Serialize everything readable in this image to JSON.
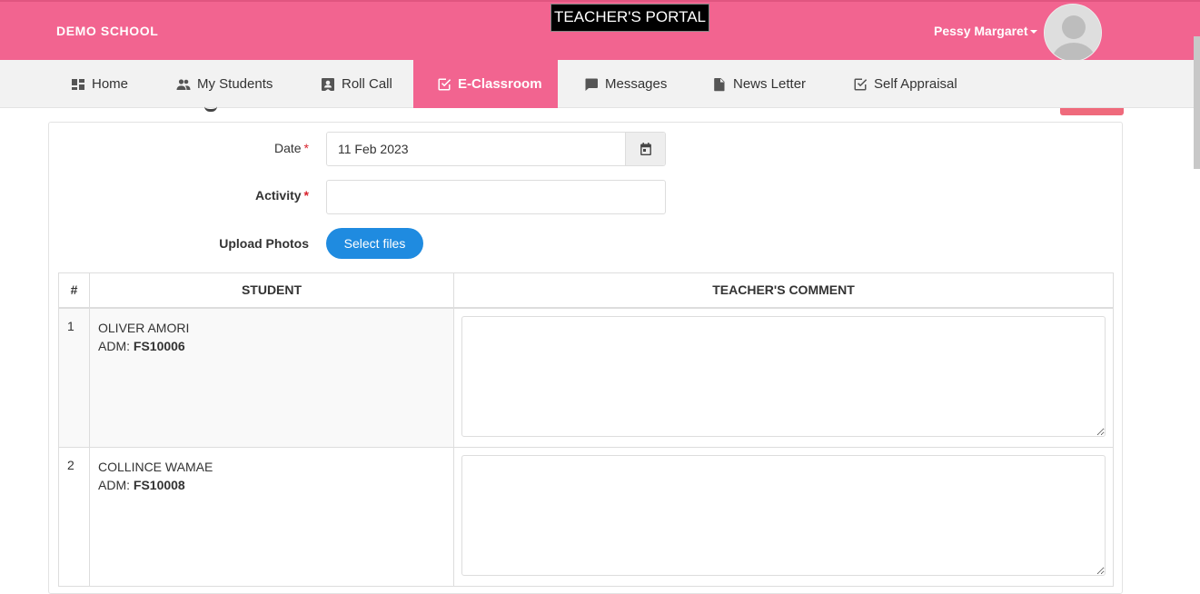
{
  "header": {
    "school_name": "DEMO SCHOOL",
    "portal_title": "TEACHER'S PORTAL",
    "user_name": "Pessy Margaret",
    "brand_color": "#f26490"
  },
  "nav": {
    "items": [
      {
        "label": "Home",
        "icon": "dashboard-icon"
      },
      {
        "label": "My Students",
        "icon": "people-icon"
      },
      {
        "label": "Roll Call",
        "icon": "id-card-icon"
      },
      {
        "label": "E-Classroom",
        "icon": "checkbox-icon",
        "active": true
      },
      {
        "label": "Messages",
        "icon": "chat-icon"
      },
      {
        "label": "News Letter",
        "icon": "document-icon"
      },
      {
        "label": "Self Appraisal",
        "icon": "checkbox-outline-icon"
      }
    ]
  },
  "form": {
    "date_label": "Date",
    "date_value": "11 Feb 2023",
    "activity_label": "Activity",
    "activity_value": "",
    "upload_label": "Upload Photos",
    "select_files": "Select files",
    "required_mark": "*"
  },
  "table": {
    "headers": [
      "#",
      "STUDENT",
      "TEACHER'S COMMENT"
    ],
    "adm_prefix": "ADM: ",
    "rows": [
      {
        "num": "1",
        "name": "OLIVER AMORI",
        "adm": "FS10006",
        "comment": ""
      },
      {
        "num": "2",
        "name": "COLLINCE WAMAE",
        "adm": "FS10008",
        "comment": ""
      }
    ]
  }
}
